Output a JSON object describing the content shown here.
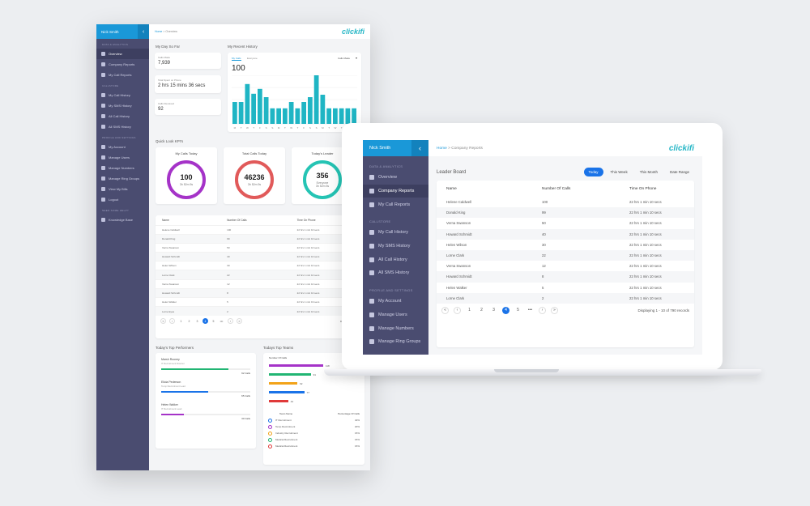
{
  "app": {
    "user_name": "Nick Smith",
    "logo": "clickifi",
    "collapse_icon": "chevron-left-icon"
  },
  "back": {
    "breadcrumb": {
      "home": "Home",
      "sep": " > ",
      "current": "Overview"
    },
    "sidebar": {
      "sections": [
        {
          "title": "DATA & ANALYTICS",
          "items": [
            {
              "label": "Overview",
              "icon": "dashboard-icon",
              "active": true
            },
            {
              "label": "Company Reports",
              "icon": "bar-chart-icon"
            },
            {
              "label": "My Call Reports",
              "icon": "line-chart-icon"
            }
          ]
        },
        {
          "title": "CALLSTORE",
          "items": [
            {
              "label": "My Call History",
              "icon": "phone-icon"
            },
            {
              "label": "My SMS History",
              "icon": "message-icon"
            },
            {
              "label": "All Call History",
              "icon": "phone-icon"
            },
            {
              "label": "All SMS History",
              "icon": "message-icon"
            }
          ]
        },
        {
          "title": "PROFILE AND SETTINGS",
          "items": [
            {
              "label": "My Account",
              "icon": "user-icon"
            },
            {
              "label": "Manage Users",
              "icon": "users-icon"
            },
            {
              "label": "Manage Numbers",
              "icon": "numbers-icon"
            },
            {
              "label": "Manage Ring Groups",
              "icon": "group-icon"
            },
            {
              "label": "View My Bills",
              "icon": "bill-icon"
            },
            {
              "label": "Logout",
              "icon": "logout-icon"
            }
          ]
        },
        {
          "title": "NEED SOME HELP?",
          "items": [
            {
              "label": "Knowledge Base",
              "icon": "book-icon"
            }
          ]
        }
      ]
    },
    "my_day_title": "My Day So Far",
    "stats": [
      {
        "label": "Calls Made",
        "value": "7,939"
      },
      {
        "label": "Total Spent on Phone",
        "value": "2 hrs 15 mins 36 secs"
      },
      {
        "label": "Calls Received",
        "value": "92"
      }
    ],
    "history": {
      "title": "My Recent History",
      "tabs": [
        "My Calls",
        "Everyone"
      ],
      "filter": "Calls Made",
      "big_value": "100",
      "chart_data": {
        "type": "bar",
        "categories": [
          "M",
          "T",
          "W",
          "T",
          "F",
          "S",
          "S",
          "M",
          "T",
          "W",
          "T",
          "F",
          "S",
          "S",
          "M",
          "T",
          "W",
          "T",
          "F",
          "S"
        ],
        "values": [
          45,
          45,
          82,
          62,
          72,
          55,
          32,
          32,
          32,
          45,
          32,
          45,
          55,
          100,
          60,
          32,
          32,
          32,
          32,
          32
        ],
        "ylim": [
          0,
          100
        ],
        "color": "#1fb5c4"
      }
    },
    "kpi_title": "Quick Look KPI's",
    "kpis": [
      {
        "label": "My Calls Today",
        "value": "100",
        "sub": "3h 52m 5s",
        "color": "#a533c8"
      },
      {
        "label": "Total Calls Today",
        "value": "46236",
        "sub": "3h 52m 5s",
        "color": "#e15a5a"
      },
      {
        "label": "Today's Leader",
        "value": "356",
        "sub": "Everyone\n3h 52m 5s",
        "color": "#25c4b4"
      }
    ],
    "table": {
      "headers": [
        "Name",
        "Number Of Calls",
        "Time On Phone"
      ],
      "rows": [
        [
          "Helene Caldwell",
          "100",
          "22 hrs 1 min 10 secs"
        ],
        [
          "Donald King",
          "99",
          "22 hrs 1 min 10 secs"
        ],
        [
          "Verna Swanson",
          "50",
          "22 hrs 1 min 10 secs"
        ],
        [
          "Howard Schmidt",
          "40",
          "22 hrs 1 min 10 secs"
        ],
        [
          "Helen Wilson",
          "30",
          "22 hrs 1 min 10 secs"
        ],
        [
          "Lorne Clark",
          "22",
          "22 hrs 1 min 10 secs"
        ],
        [
          "Verna Swanson",
          "12",
          "22 hrs 1 min 10 secs"
        ],
        [
          "Howard Schmidt",
          "8",
          "22 hrs 1 min 10 secs"
        ],
        [
          "Helen Walker",
          "5",
          "22 hrs 1 min 19 secs"
        ],
        [
          "Lorne Eyes",
          "2",
          "22 hrs 1 min 10 secs"
        ]
      ],
      "pages": [
        "1",
        "2",
        "3",
        "4",
        "5",
        "•••"
      ],
      "display": "Displaying 1 - 10 of..."
    },
    "performers": {
      "title": "Today's Top Performers",
      "items": [
        {
          "name": "Marsh Rooney",
          "role": "IT Recruitment Director",
          "calls": "92 Calls",
          "pct": 0.75,
          "color": "#21b573"
        },
        {
          "name": "Elicia Pederson",
          "role": "Temp Recruitment Lead",
          "calls": "65 Calls",
          "pct": 0.53,
          "color": "#1a73e8"
        },
        {
          "name": "Helen Walker",
          "role": "IT Recruitment Lead",
          "calls": "30 Calls",
          "pct": 0.25,
          "color": "#a533c8"
        }
      ]
    },
    "teams": {
      "title": "Todays Top Teams",
      "axis_label": "Number Of Calls",
      "chart_data": {
        "type": "bar",
        "values": [
          118,
          91,
          62,
          77,
          42
        ],
        "xlim": [
          0,
          150
        ],
        "colors": [
          "#a533c8",
          "#21b573",
          "#f2a319",
          "#1a73e8",
          "#e03a3a"
        ]
      },
      "legend_headers": [
        "Team Name",
        "Percentage Of Calls"
      ],
      "legend": [
        {
          "name": "IT Recruitment",
          "pct": "40%",
          "color": "#1a73e8"
        },
        {
          "name": "Temp Recruitment",
          "pct": "20%",
          "color": "#a533c8"
        },
        {
          "name": "Industry Recruitment",
          "pct": "15%",
          "color": "#f2a319"
        },
        {
          "name": "Medical Recruitment",
          "pct": "15%",
          "color": "#21b573"
        },
        {
          "name": "Medical Recruitment",
          "pct": "15%",
          "color": "#e03a3a"
        }
      ]
    }
  },
  "front": {
    "breadcrumb": {
      "home": "Home",
      "sep": " > ",
      "current": "Company Reports"
    },
    "sidebar": {
      "sections": [
        {
          "title": "DATA & ANALYTICS",
          "items": [
            {
              "label": "Overview",
              "icon": "dashboard-icon"
            },
            {
              "label": "Company Reports",
              "icon": "bar-chart-icon",
              "active": true
            },
            {
              "label": "My Call Reports",
              "icon": "line-chart-icon"
            }
          ]
        },
        {
          "title": "CALLSTORE",
          "items": [
            {
              "label": "My Call History",
              "icon": "phone-icon"
            },
            {
              "label": "My SMS History",
              "icon": "message-icon"
            },
            {
              "label": "All Call History",
              "icon": "phone-icon"
            },
            {
              "label": "All SMS History",
              "icon": "message-icon"
            }
          ]
        },
        {
          "title": "PROFILE AND SETTINGS",
          "items": [
            {
              "label": "My Account",
              "icon": "user-icon"
            },
            {
              "label": "Manage Users",
              "icon": "users-icon"
            },
            {
              "label": "Manage Numbers",
              "icon": "numbers-icon"
            },
            {
              "label": "Manage Ring Groups",
              "icon": "group-icon"
            }
          ]
        }
      ]
    },
    "leader_title": "Leader Board",
    "tabs": [
      {
        "label": "Today",
        "active": true
      },
      {
        "label": "This Week"
      },
      {
        "label": "This Month"
      },
      {
        "label": "Date Range"
      }
    ],
    "table": {
      "headers": [
        "Name",
        "Number Of Calls",
        "Time On Phone"
      ],
      "rows": [
        [
          "Helene Caldwell",
          "100",
          "22 hrs 1 min 10 secs"
        ],
        [
          "Donald King",
          "99",
          "22 hrs 1 min 10 secs"
        ],
        [
          "Verna Swanson",
          "50",
          "22 hrs 1 min 10 secs"
        ],
        [
          "Howard Schmidt",
          "40",
          "22 hrs 1 min 10 secs"
        ],
        [
          "Helen Wilson",
          "30",
          "22 hrs 1 min 10 secs"
        ],
        [
          "Lorne Clark",
          "22",
          "22 hrs 1 min 10 secs"
        ],
        [
          "Verna Swanson",
          "12",
          "22 hrs 1 min 10 secs"
        ],
        [
          "Howard Schmidt",
          "8",
          "22 hrs 1 min 10 secs"
        ],
        [
          "Helen Walker",
          "5",
          "22 hrs 1 min 10 secs"
        ],
        [
          "Lorne Clark",
          "2",
          "22 hrs 1 min 10 secs"
        ]
      ],
      "pages": [
        "1",
        "2",
        "3",
        "4",
        "5",
        "•••"
      ],
      "active_page": "4",
      "display": "Displaying 1 - 10 of 790 records"
    }
  }
}
